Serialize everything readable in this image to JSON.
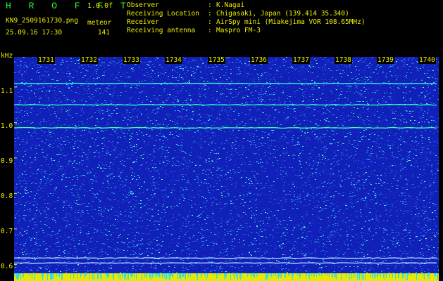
{
  "app": {
    "title": "H R O F F T",
    "version": "1.0.0f",
    "filename": "KN9_2509161730.png",
    "datetime": "25.09.16 17:30",
    "meteor_label": "meteor",
    "meteor_count": "141"
  },
  "info": [
    {
      "label": "Observer",
      "value": "K.Nagai"
    },
    {
      "label": "Receiving Location",
      "value": "Chigasaki, Japan (139.414 35.340)"
    },
    {
      "label": "Receiver",
      "value": "AirSpy mini (Miakejima VOR 108.65MHz)"
    },
    {
      "label": "Receiving antenna",
      "value": "Maspro FM-3"
    }
  ],
  "separator": ":",
  "axis": {
    "unit": "kHz",
    "y_ticks": [
      "1.1",
      "1.0",
      "0.9",
      "0.8",
      "0.7",
      "0.6"
    ],
    "y_values": [
      1.1,
      1.0,
      0.9,
      0.8,
      0.7,
      0.6
    ],
    "y_range": [
      0.575,
      1.185
    ],
    "time_ticks": [
      "1731",
      "1732",
      "1733",
      "1734",
      "1735",
      "1736",
      "1737",
      "1738",
      "1739",
      "1740"
    ]
  },
  "signals": [
    {
      "freq": 1.11,
      "color": "#38ffd8"
    },
    {
      "freq": 1.05,
      "color": "#38ffd8"
    },
    {
      "freq": 0.985,
      "color": "#38ffb8"
    },
    {
      "freq": 0.618,
      "color": "#b8e0ff"
    },
    {
      "freq": 0.604,
      "color": "#b8e0ff"
    }
  ],
  "colors": {
    "background": "#1020b8",
    "noise": [
      "#1a3cd0",
      "#2f64e8",
      "#20a0f0",
      "#30e0e8",
      "#70ffb0"
    ],
    "text": "#f0f000",
    "title": "#2fff2f",
    "bottom_band": "#e8e800"
  }
}
